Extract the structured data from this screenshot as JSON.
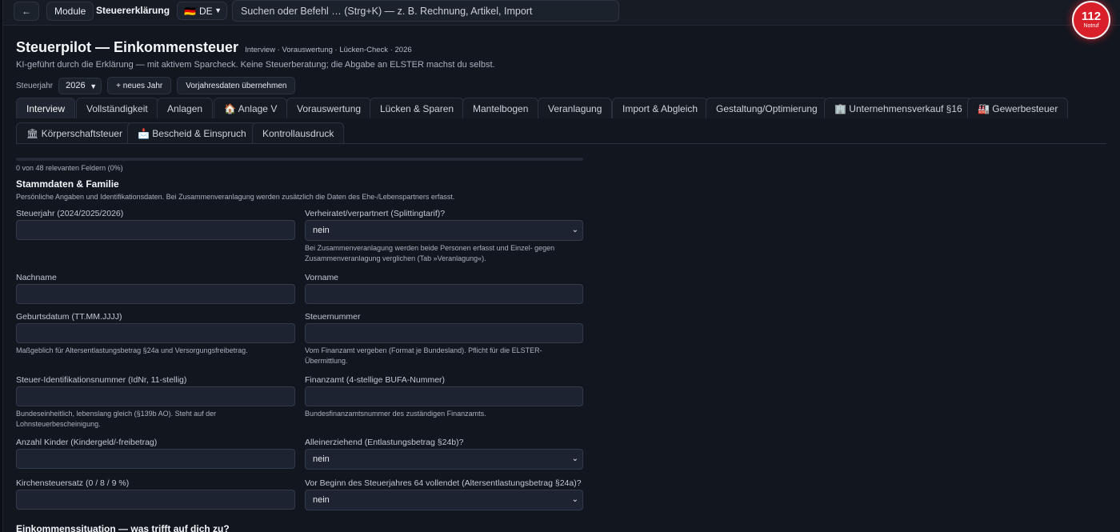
{
  "topbar": {
    "back_label": "←",
    "module_label": "Module",
    "app_title": "Steuererklärung",
    "lang_flag": "🇩🇪",
    "lang_code": "DE",
    "search_placeholder": "Suchen oder Befehl … (Strg+K) — z. B. Rechnung, Artikel, Import"
  },
  "emergency": {
    "number": "112",
    "label": "Notruf",
    "color": "#d9202a"
  },
  "header": {
    "title": "Steuerpilot — Einkommensteuer",
    "subtitle": "Interview · Vorauswertung · Lücken-Check · 2026",
    "description": "KI-geführt durch die Erklärung — mit aktivem Sparcheck. Keine Steuerberatung; die Abgabe an ELSTER machst du selbst.",
    "year_label": "Steuerjahr",
    "year_value": "2026",
    "new_year_button": "+ neues Jahr",
    "prev_year_button": "Vorjahresdaten übernehmen"
  },
  "tabs": [
    {
      "label": "Interview",
      "active": true
    },
    {
      "label": "Vollständigkeit"
    },
    {
      "label": "Anlagen"
    },
    {
      "label": "🏠 Anlage V"
    },
    {
      "label": "Vorauswertung"
    },
    {
      "label": "Lücken & Sparen"
    },
    {
      "label": "Mantelbogen"
    },
    {
      "label": "Veranlagung"
    },
    {
      "label": "Import & Abgleich"
    },
    {
      "label": "Gestaltung/Optimierung"
    },
    {
      "label": "🏢 Unternehmensverkauf §16"
    },
    {
      "label": "🏭 Gewerbesteuer"
    },
    {
      "label": "🏛 Körperschaftsteuer"
    },
    {
      "label": "📩 Bescheid & Einspruch"
    },
    {
      "label": "Kontrollausdruck"
    }
  ],
  "progress": {
    "text": "0 von 48 relevanten Feldern (0%)",
    "fraction": 0
  },
  "section1": {
    "title": "Stammdaten & Familie",
    "description": "Persönliche Angaben und Identifikationsdaten. Bei Zusammenveranlagung werden zusätzlich die Daten des Ehe-/Lebenspartners erfasst.",
    "fields": {
      "steuerjahr": {
        "label": "Steuerjahr (2024/2025/2026)",
        "value": ""
      },
      "verheiratet": {
        "label": "Verheiratet/verpartnert (Splittingtarif)?",
        "value": "nein",
        "hint": "Bei Zusammenveranlagung werden beide Personen erfasst und Einzel- gegen Zusammenveranlagung verglichen (Tab »Veranlagung«)."
      },
      "nachname": {
        "label": "Nachname",
        "value": ""
      },
      "vorname": {
        "label": "Vorname",
        "value": ""
      },
      "geburtsdatum": {
        "label": "Geburtsdatum (TT.MM.JJJJ)",
        "value": "",
        "hint": "Maßgeblich für Altersentlastungsbetrag §24a und Versorgungsfreibetrag."
      },
      "steuernummer": {
        "label": "Steuernummer",
        "value": "",
        "hint": "Vom Finanzamt vergeben (Format je Bundesland). Pflicht für die ELSTER-Übermittlung."
      },
      "idnr": {
        "label": "Steuer-Identifikationsnummer (IdNr, 11-stellig)",
        "value": "",
        "hint": "Bundeseinheitlich, lebenslang gleich (§139b AO). Steht auf der Lohnsteuerbescheinigung."
      },
      "finanzamt": {
        "label": "Finanzamt (4-stellige BUFA-Nummer)",
        "value": "",
        "hint": "Bundesfinanzamtsnummer des zuständigen Finanzamts."
      },
      "kinder": {
        "label": "Anzahl Kinder (Kindergeld/-freibetrag)",
        "value": ""
      },
      "alleinerziehend": {
        "label": "Alleinerziehend (Entlastungsbetrag §24b)?",
        "value": "nein"
      },
      "kirchensteuer": {
        "label": "Kirchensteuersatz (0 / 8 / 9 %)",
        "value": ""
      },
      "alter64": {
        "label": "Vor Beginn des Steuerjahres 64 vollendet (Altersentlastungsbetrag §24a)?",
        "value": "nein"
      }
    }
  },
  "section2": {
    "title": "Einkommenssituation — was trifft auf dich zu?"
  }
}
